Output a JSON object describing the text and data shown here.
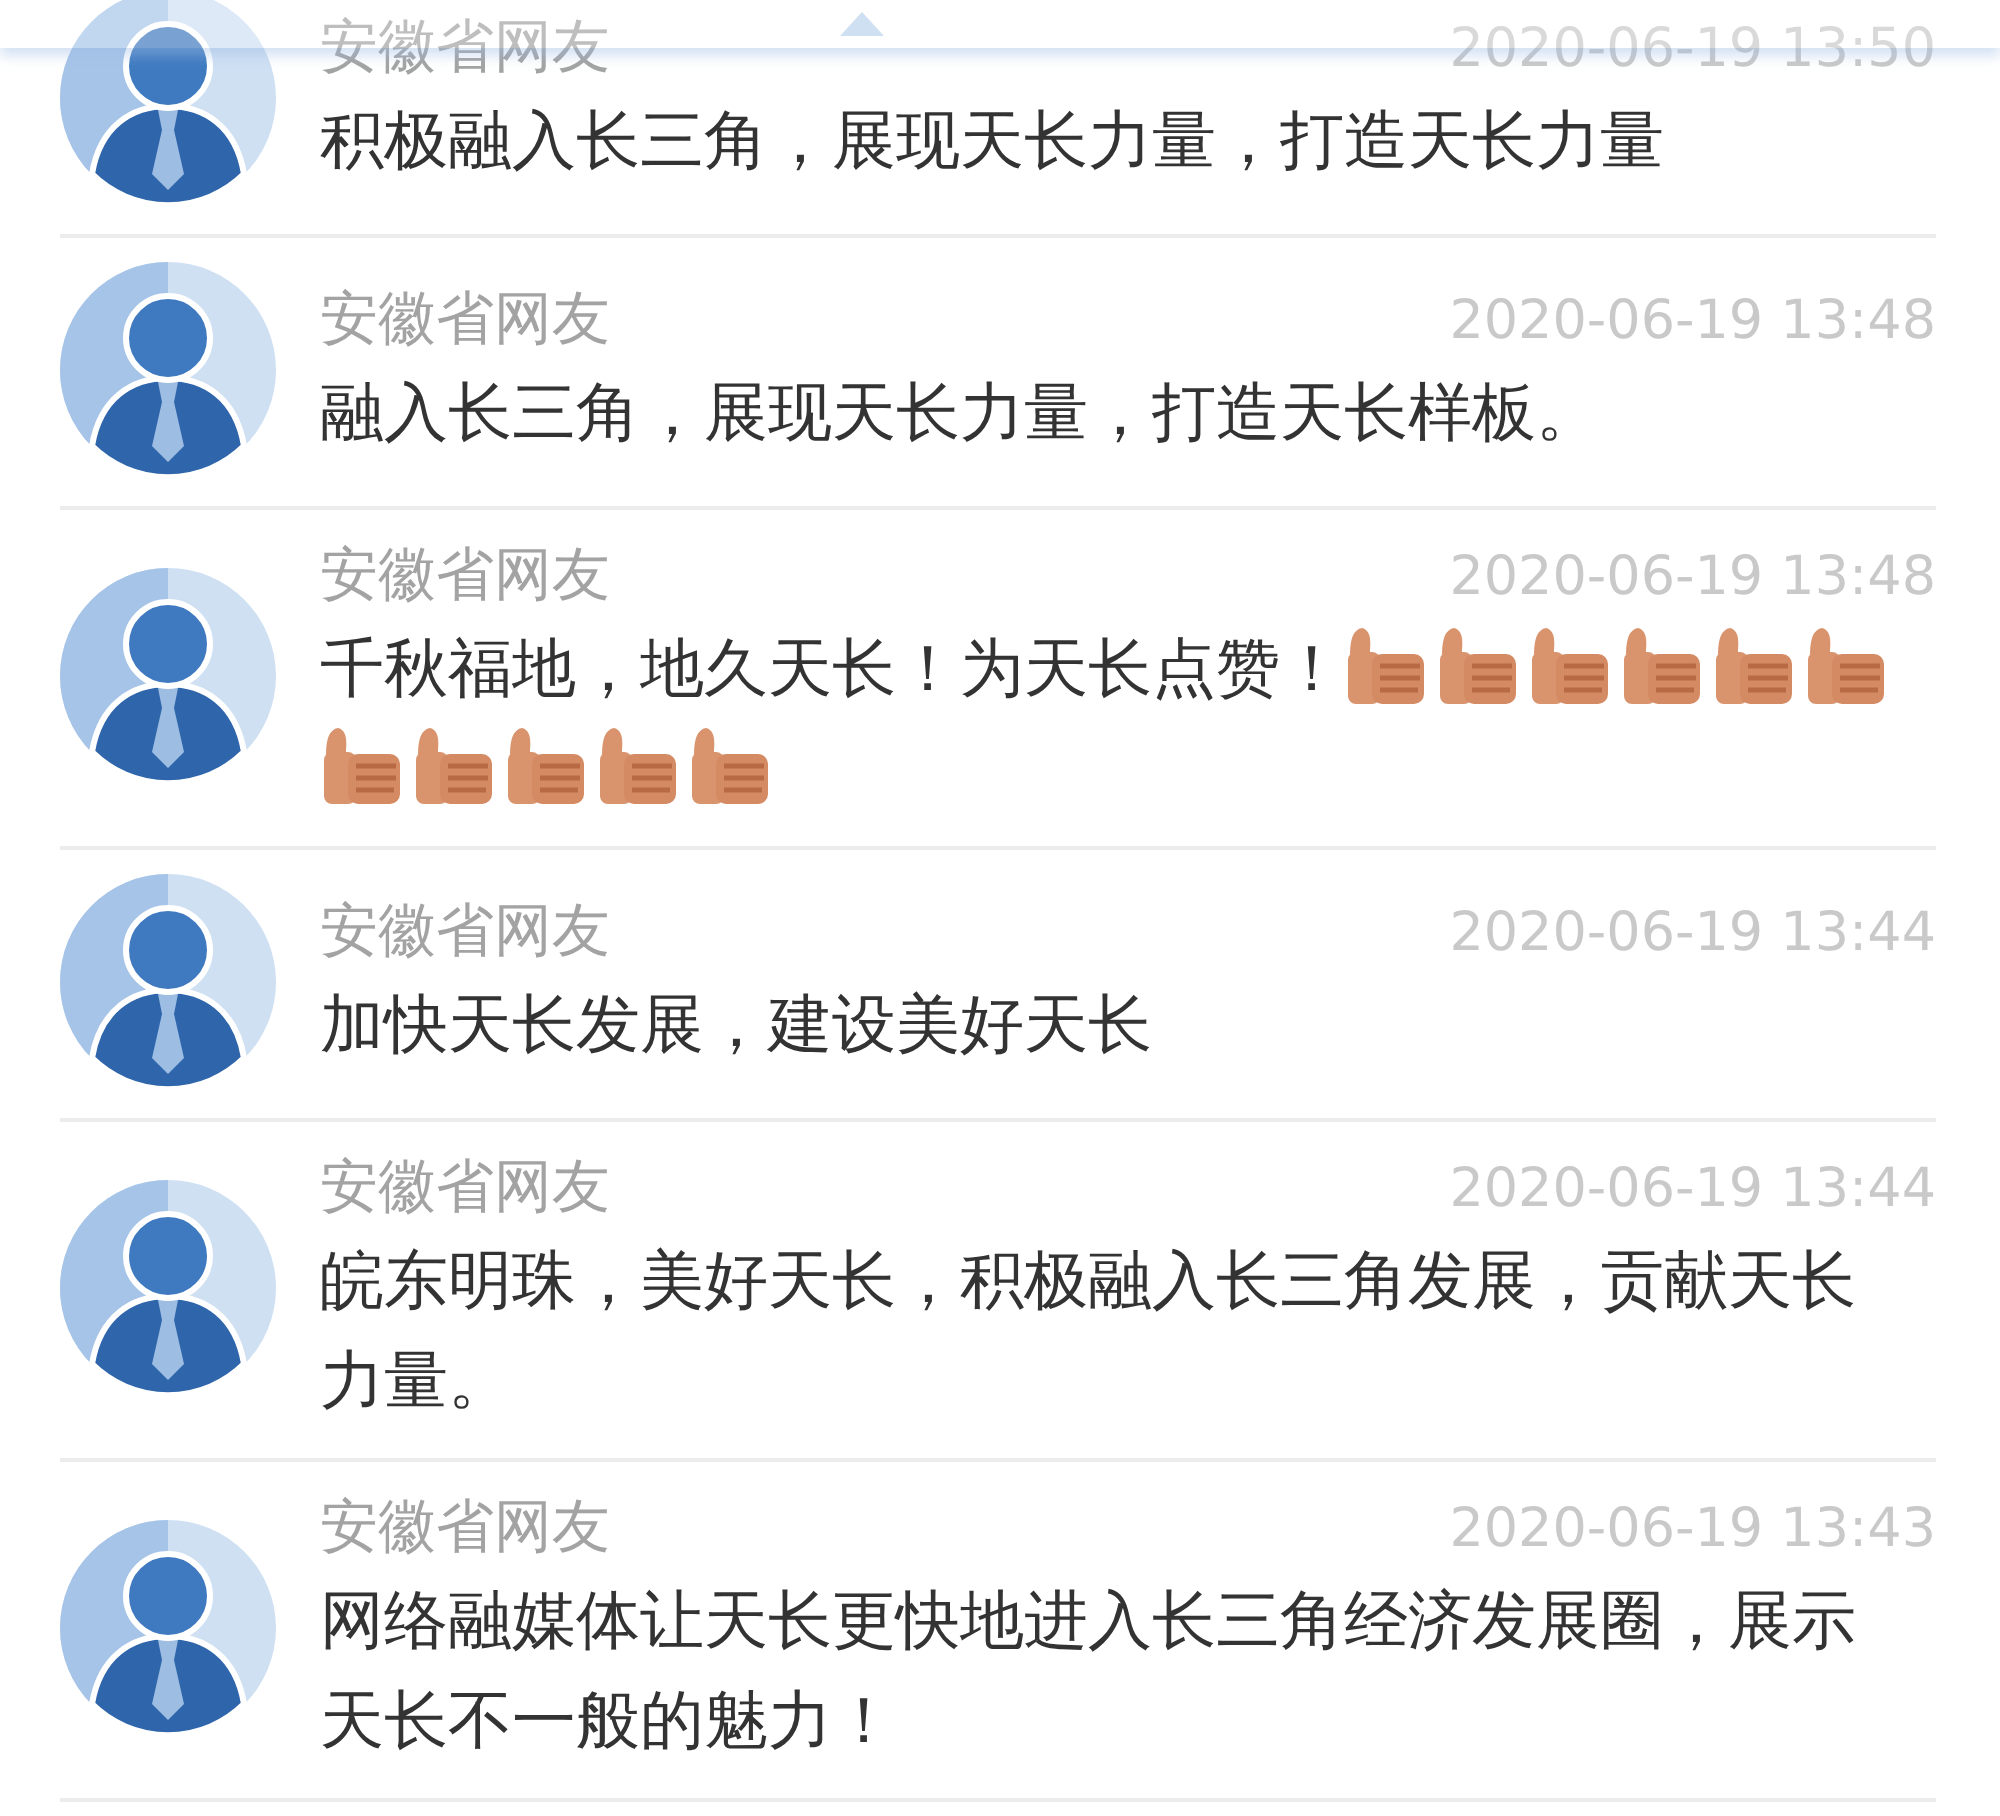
{
  "comments": [
    {
      "author": "安徽省网友",
      "time": "2020-06-19 13:50",
      "text": "积极融入长三角，展现天长力量，打造天长力量"
    },
    {
      "author": "安徽省网友",
      "time": "2020-06-19 13:48",
      "text": "融入长三角，展现天长力量，打造天长样板。"
    },
    {
      "author": "安徽省网友",
      "time": "2020-06-19 13:48",
      "text": "千秋福地，地久天长！为天长点赞！",
      "emoji": [
        {
          "kind": "thumbs-up"
        },
        {
          "kind": "thumbs-up"
        },
        {
          "kind": "thumbs-up"
        },
        {
          "kind": "thumbs-up"
        },
        {
          "kind": "thumbs-up"
        },
        {
          "kind": "thumbs-up"
        },
        {
          "kind": "thumbs-up"
        },
        {
          "kind": "thumbs-up"
        },
        {
          "kind": "thumbs-up"
        },
        {
          "kind": "thumbs-up"
        },
        {
          "kind": "thumbs-up"
        }
      ]
    },
    {
      "author": "安徽省网友",
      "time": "2020-06-19 13:44",
      "text": "加快天长发展，建设美好天长"
    },
    {
      "author": "安徽省网友",
      "time": "2020-06-19 13:44",
      "text": "皖东明珠，美好天长，积极融入长三角发展，贡献天长力量。"
    },
    {
      "author": "安徽省网友",
      "time": "2020-06-19 13:43",
      "text": "网络融媒体让天长更快地进入长三角经济发展圈，展示天长不一般的魅力！"
    }
  ]
}
